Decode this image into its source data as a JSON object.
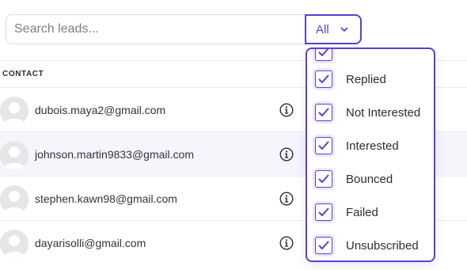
{
  "search": {
    "placeholder": "Search leads..."
  },
  "filter": {
    "label": "All",
    "icon": "chevron-down-icon"
  },
  "table": {
    "column_header": "CONTACT"
  },
  "rows": [
    {
      "email": "dubois.maya2@gmail.com",
      "highlighted": false
    },
    {
      "email": "johnson.martin9833@gmail.com",
      "highlighted": true
    },
    {
      "email": "stephen.kawn98@gmail.com",
      "highlighted": false
    },
    {
      "email": "dayarisolli@gmail.com",
      "highlighted": false
    }
  ],
  "dropdown": {
    "options": [
      {
        "label": "",
        "checked": true
      },
      {
        "label": "Replied",
        "checked": true
      },
      {
        "label": "Not Interested",
        "checked": true
      },
      {
        "label": "Interested",
        "checked": true
      },
      {
        "label": "Bounced",
        "checked": true
      },
      {
        "label": "Failed",
        "checked": true
      },
      {
        "label": "Unsubscribed",
        "checked": true
      }
    ]
  },
  "colors": {
    "accent": "#5b3fd6",
    "row_highlight": "#f6f5fc",
    "border": "#ececf2"
  }
}
